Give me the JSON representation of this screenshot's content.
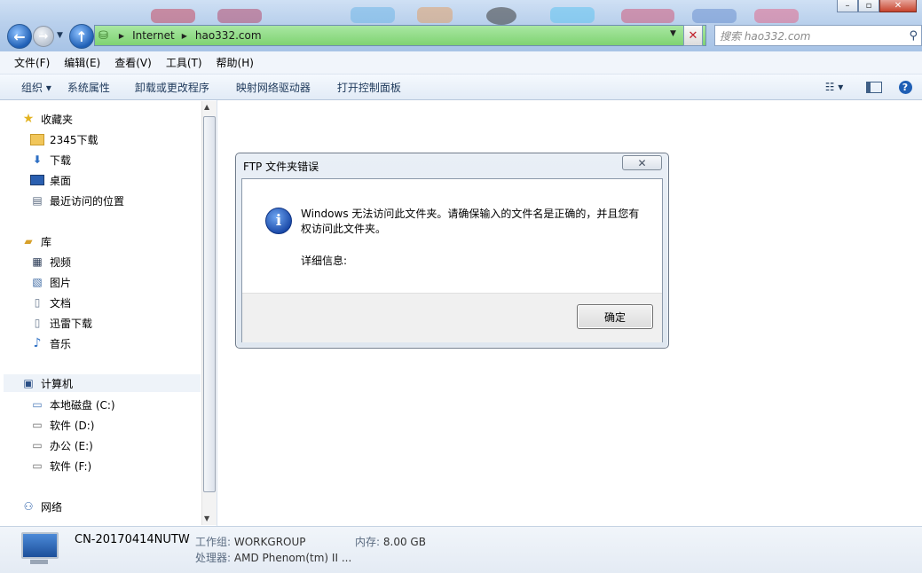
{
  "address_bar": {
    "segments": [
      "Internet",
      "hao332.com"
    ],
    "search_placeholder": "搜索 hao332.com"
  },
  "menu": [
    "文件(F)",
    "编辑(E)",
    "查看(V)",
    "工具(T)",
    "帮助(H)"
  ],
  "commands": [
    "组织 ▾",
    "系统属性",
    "卸载或更改程序",
    "映射网络驱动器",
    "打开控制面板"
  ],
  "nav": {
    "favorites": {
      "title": "收藏夹",
      "items": [
        "2345下载",
        "下载",
        "桌面",
        "最近访问的位置"
      ]
    },
    "libraries": {
      "title": "库",
      "items": [
        "视频",
        "图片",
        "文档",
        "迅雷下载",
        "音乐"
      ]
    },
    "computer": {
      "title": "计算机",
      "items": [
        "本地磁盘 (C:)",
        "软件 (D:)",
        "办公 (E:)",
        "软件 (F:)"
      ]
    },
    "network": {
      "title": "网络"
    }
  },
  "details": {
    "computer_name": "CN-20170414NUTW",
    "workgroup_label": "工作组:",
    "workgroup_value": "WORKGROUP",
    "memory_label": "内存:",
    "memory_value": "8.00 GB",
    "processor_label": "处理器:",
    "processor_value": "AMD Phenom(tm) II ..."
  },
  "dialog": {
    "title": "FTP 文件夹错误",
    "message": "Windows 无法访问此文件夹。请确保输入的文件名是正确的，并且您有权访问此文件夹。",
    "details_label": "详细信息:",
    "ok_label": "确定"
  },
  "colors": {
    "address_bar_fill": "#8fdc84",
    "accent_blue": "#1f5fb5",
    "dialog_frame": "#dfe7f0"
  }
}
